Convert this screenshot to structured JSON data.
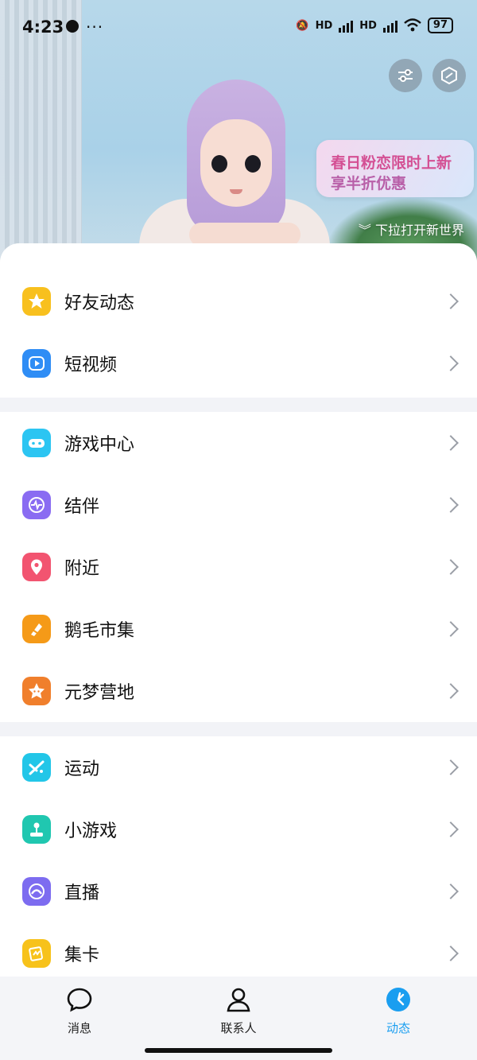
{
  "status_bar": {
    "time": "4:23",
    "more": "···",
    "hd1": "HD",
    "hd2": "HD",
    "battery": "97"
  },
  "hero": {
    "promo_line1": "春日粉恋限时上新",
    "promo_line2": "享半折优惠",
    "pull_hint": "下拉打开新世界"
  },
  "groups": [
    {
      "items": [
        {
          "label": "好友动态",
          "icon": "friend-feed-star-icon",
          "color": "#f8c01e"
        },
        {
          "label": "短视频",
          "icon": "short-video-play-icon",
          "color": "#2f8df5"
        }
      ]
    },
    {
      "items": [
        {
          "label": "游戏中心",
          "icon": "gamepad-icon",
          "color": "#2cc5f2"
        },
        {
          "label": "结伴",
          "icon": "pulse-icon",
          "color": "#8a6cf2"
        },
        {
          "label": "附近",
          "icon": "location-pin-icon",
          "color": "#f25470"
        },
        {
          "label": "鹅毛市集",
          "icon": "feather-tag-icon",
          "color": "#f59a18"
        },
        {
          "label": "元梦营地",
          "icon": "star-face-icon",
          "color": "#f07f2c"
        }
      ]
    },
    {
      "items": [
        {
          "label": "运动",
          "icon": "running-icon",
          "color": "#22c6e8"
        },
        {
          "label": "小游戏",
          "icon": "joystick-icon",
          "color": "#20c7b0"
        },
        {
          "label": "直播",
          "icon": "live-arc-icon",
          "color": "#7d6cf0"
        },
        {
          "label": "集卡",
          "icon": "cards-icon",
          "color": "#f7c21b"
        }
      ]
    }
  ],
  "tabs": [
    {
      "label": "消息",
      "icon": "message-bubble-icon"
    },
    {
      "label": "联系人",
      "icon": "contact-person-icon"
    },
    {
      "label": "动态",
      "icon": "dynamic-star-icon",
      "active": true
    }
  ],
  "colors": {
    "accent": "#1a9ef0"
  }
}
